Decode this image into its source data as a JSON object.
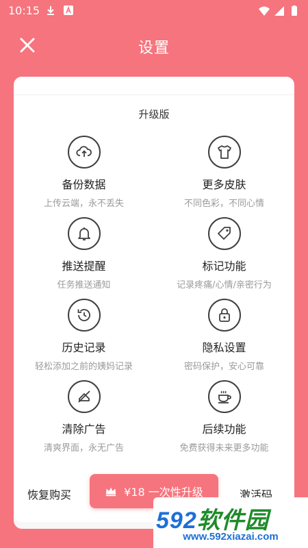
{
  "status_bar": {
    "time": "10:15",
    "icons": [
      "download-icon",
      "a-box-icon",
      "wifi-icon",
      "signal-icon",
      "battery-icon"
    ]
  },
  "header": {
    "title": "设置",
    "close_icon": "close-icon"
  },
  "section_title": "升级版",
  "features": [
    {
      "icon": "cloud-upload-icon",
      "title": "备份数据",
      "subtitle": "上传云端，永不丢失"
    },
    {
      "icon": "tshirt-icon",
      "title": "更多皮肤",
      "subtitle": "不同色彩，不同心情"
    },
    {
      "icon": "bell-icon",
      "title": "推送提醒",
      "subtitle": "任务推送通知"
    },
    {
      "icon": "tag-icon",
      "title": "标记功能",
      "subtitle": "记录疼痛/心情/亲密行为"
    },
    {
      "icon": "history-icon",
      "title": "历史记录",
      "subtitle": "轻松添加之前的姨妈记录"
    },
    {
      "icon": "lock-icon",
      "title": "隐私设置",
      "subtitle": "密码保护，安心可靠"
    },
    {
      "icon": "no-ads-icon",
      "title": "清除广告",
      "subtitle": "清爽界面，永无广告"
    },
    {
      "icon": "coffee-icon",
      "title": "后续功能",
      "subtitle": "免费获得未来更多功能"
    }
  ],
  "actions": {
    "restore": "恢复购买",
    "upgrade": "¥18 一次性升级",
    "activate": "激活码"
  },
  "watermark": {
    "brand_num": "592",
    "brand_cn": "软件园",
    "url": "www.592xiazai.com"
  },
  "colors": {
    "accent": "#f6747d",
    "text": "#222222",
    "subtext": "#9a9a9a"
  }
}
